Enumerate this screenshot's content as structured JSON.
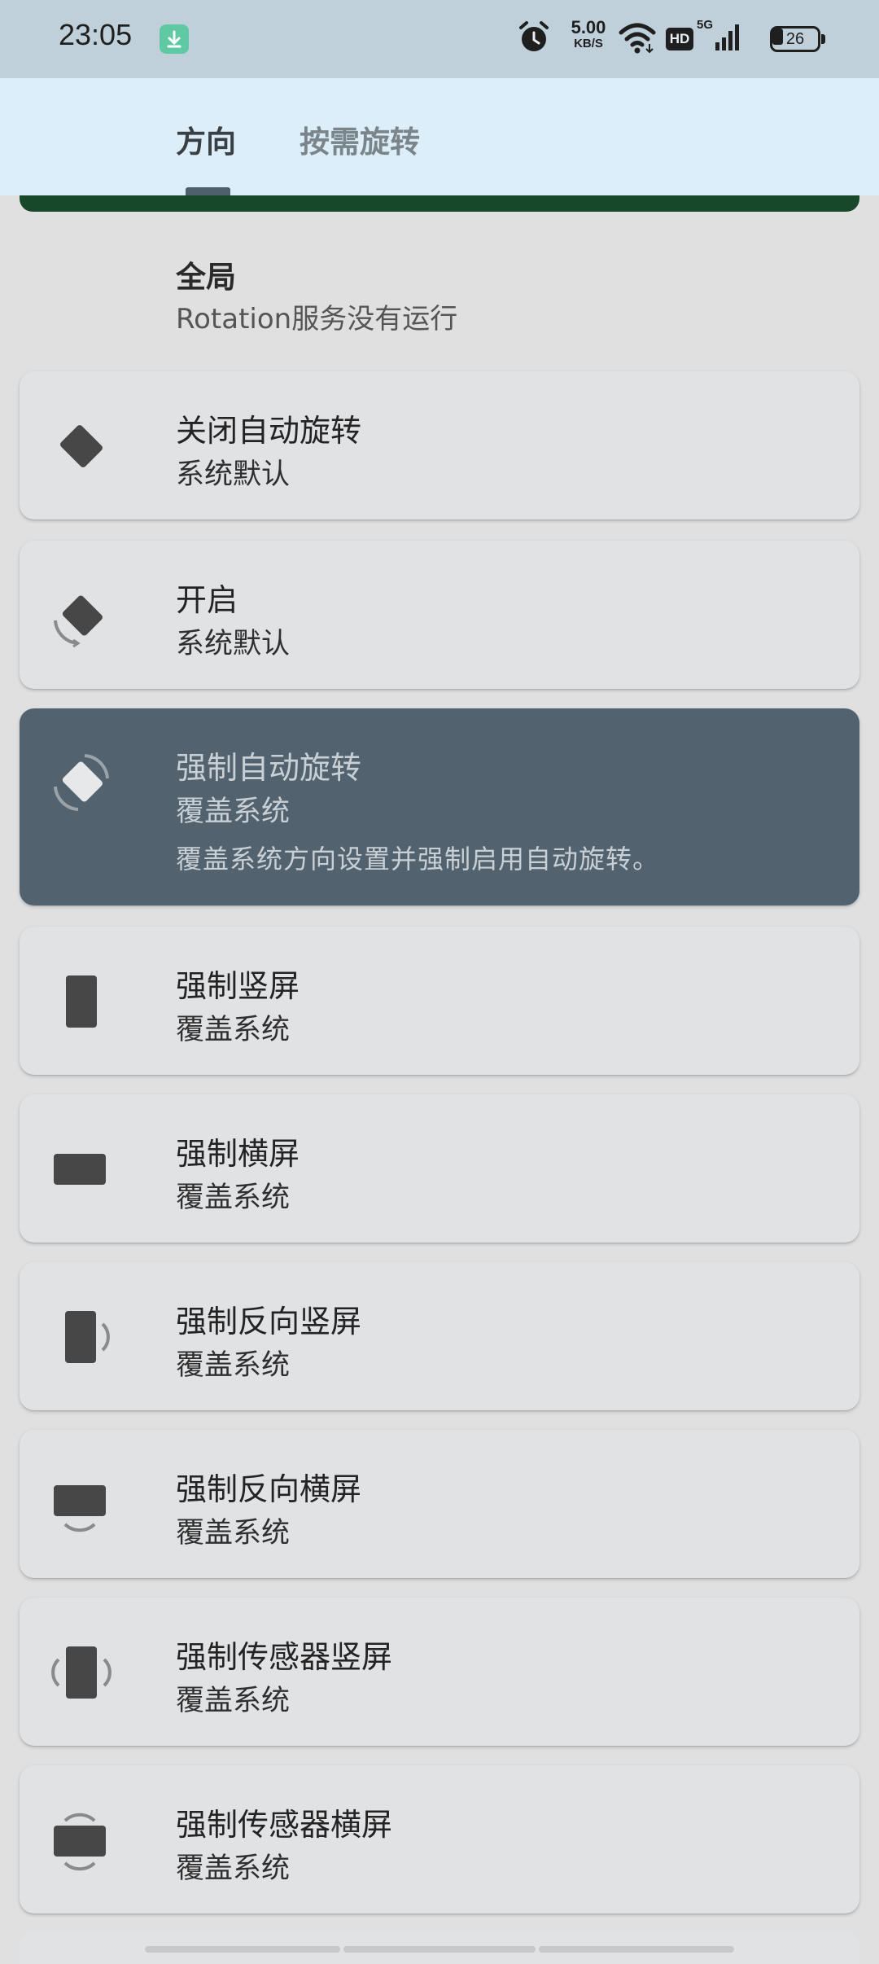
{
  "status_bar": {
    "time": "23:05",
    "speed_value": "5.00",
    "speed_unit": "KB/S",
    "hd": "HD",
    "network": "5G",
    "battery": "26"
  },
  "tabs": [
    {
      "label": "方向",
      "active": true
    },
    {
      "label": "按需旋转",
      "active": false
    }
  ],
  "global": {
    "title": "全局",
    "subtitle": "Rotation服务没有运行"
  },
  "options": [
    {
      "title": "关闭自动旋转",
      "subtitle": "系统默认",
      "icon": "rotation-lock-icon"
    },
    {
      "title": "开启",
      "subtitle": "系统默认",
      "icon": "auto-rotate-icon"
    },
    {
      "title": "强制自动旋转",
      "subtitle": "覆盖系统",
      "description": "覆盖系统方向设置并强制启用自动旋转。",
      "icon": "force-auto-rotate-icon",
      "selected": true
    },
    {
      "title": "强制竖屏",
      "subtitle": "覆盖系统",
      "icon": "portrait-icon"
    },
    {
      "title": "强制横屏",
      "subtitle": "覆盖系统",
      "icon": "landscape-icon"
    },
    {
      "title": "强制反向竖屏",
      "subtitle": "覆盖系统",
      "icon": "reverse-portrait-icon"
    },
    {
      "title": "强制反向横屏",
      "subtitle": "覆盖系统",
      "icon": "reverse-landscape-icon"
    },
    {
      "title": "强制传感器竖屏",
      "subtitle": "覆盖系统",
      "icon": "sensor-portrait-icon"
    },
    {
      "title": "强制传感器横屏",
      "subtitle": "覆盖系统",
      "icon": "sensor-landscape-icon"
    }
  ],
  "colors": {
    "tab_bar": "#dbeef9",
    "status_bar": "#bfd0da",
    "selected_card": "#52626e",
    "card": "#e1e2e4",
    "accent_bar": "#17482a"
  }
}
